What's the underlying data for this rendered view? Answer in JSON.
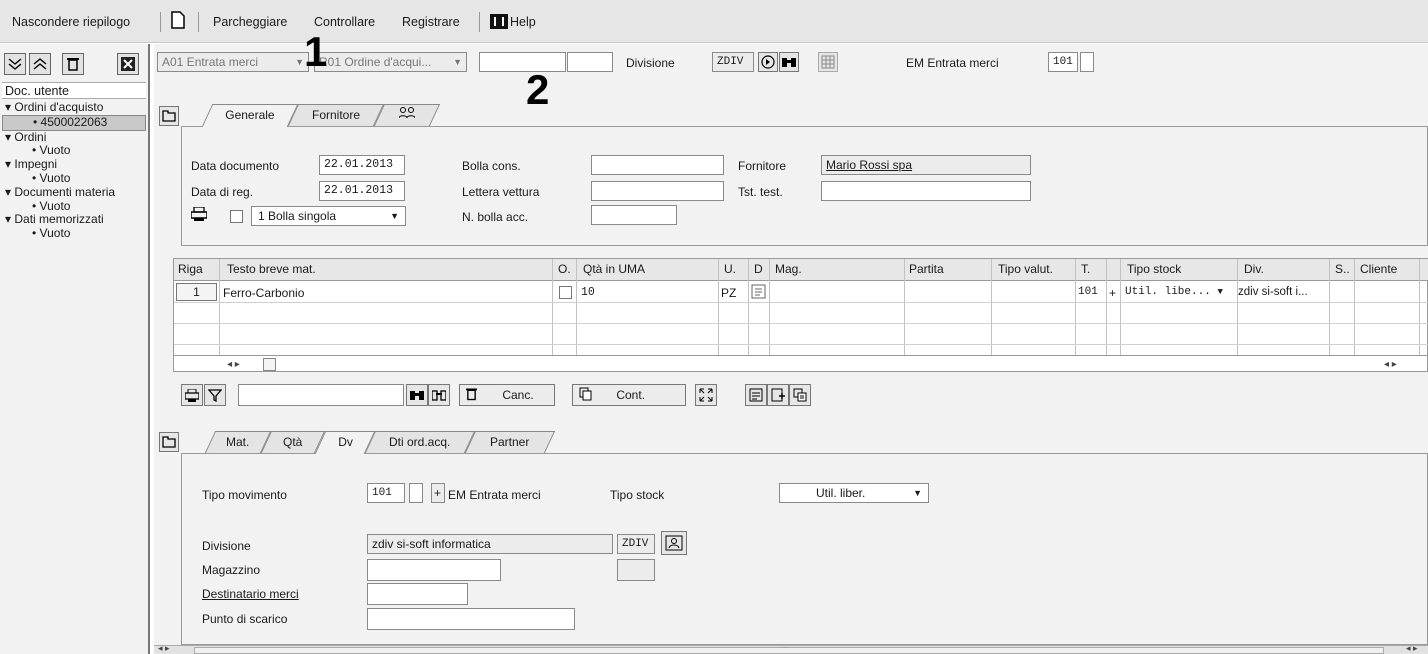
{
  "menubar": {
    "hide_summary": "Nascondere riepilogo",
    "park": "Parcheggiare",
    "check": "Controllare",
    "register": "Registrare",
    "help": "Help"
  },
  "sidebar": {
    "title": "Doc. utente",
    "tree": [
      {
        "label": "Ordini d'acquisto",
        "child": "4500022063",
        "selected": true
      },
      {
        "label": "Ordini",
        "child": "Vuoto"
      },
      {
        "label": "Impegni",
        "child": "Vuoto"
      },
      {
        "label": "Documenti materia",
        "child": "Vuoto"
      },
      {
        "label": "Dati memorizzati",
        "child": "Vuoto"
      }
    ]
  },
  "header": {
    "transaction": "A01 Entrata merci",
    "reference": "R01 Ordine d'acqui...",
    "field1": "",
    "field2": "",
    "division_label": "Divisione",
    "division_value": "ZDIV",
    "mov_label": "EM Entrata merci",
    "mov_value": "101",
    "mov_extra": ""
  },
  "annotations": {
    "one": "1",
    "two": "2"
  },
  "header_tabs": [
    "Generale",
    "Fornitore"
  ],
  "general": {
    "doc_date_label": "Data documento",
    "doc_date": "22.01.2013",
    "reg_date_label": "Data di reg.",
    "reg_date": "22.01.2013",
    "slip_option": "1 Bolla singola",
    "bolla_cons_label": "Bolla cons.",
    "bolla_cons": "",
    "lettera_label": "Lettera vettura",
    "lettera": "",
    "n_bolla_label": "N. bolla acc.",
    "n_bolla": "",
    "fornitore_label": "Fornitore",
    "fornitore": "Mario Rossi spa",
    "tst_label": "Tst. test.",
    "tst": ""
  },
  "grid": {
    "columns": [
      "Riga",
      "Testo breve mat.",
      "O.",
      "Qtà in UMA",
      "U.",
      "D",
      "Mag.",
      "Partita",
      "Tipo valut.",
      "T.",
      "Tipo stock",
      "Div.",
      "S..",
      "Cliente"
    ],
    "rows": [
      {
        "riga": "1",
        "testo": "Ferro-Carbonio",
        "qta": "10",
        "um": "PZ",
        "t": "101",
        "plus": "+",
        "tipo_stock": "Util. libe...",
        "div": "zdiv si-soft i..."
      }
    ]
  },
  "grid_toolbar": {
    "search": "",
    "delete": "Canc.",
    "copy": "Cont."
  },
  "item_tabs": [
    "Mat.",
    "Qtà",
    "Dv",
    "Dti ord.acq.",
    "Partner"
  ],
  "item": {
    "mov_type_label": "Tipo movimento",
    "mov_type": "101",
    "mov_type_extra": "",
    "mov_sign": "+",
    "mov_desc": "EM Entrata merci",
    "stock_type_label": "Tipo stock",
    "stock_type": "Util. liber.",
    "division_label": "Divisione",
    "division": "zdiv si-soft informatica",
    "division_code": "ZDIV",
    "storage_label": "Magazzino",
    "storage": "",
    "storage_code": "",
    "recipient_label": "Destinatario merci",
    "recipient": "",
    "unload_label": "Punto di scarico",
    "unload": ""
  },
  "footer": {
    "grip": "..."
  }
}
